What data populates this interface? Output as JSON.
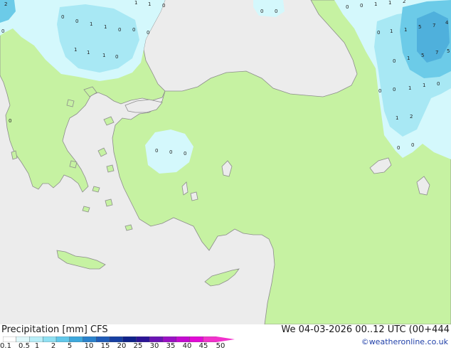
{
  "map": {
    "colors": {
      "sea": "#ececec",
      "land": "#c6f2a2",
      "coast": "#8c8c8c",
      "precip_light": "#d4f8fc",
      "precip_mid": "#a8e8f4",
      "precip_heavy": "#6ccbe8",
      "precip_max": "#4fb0dc"
    },
    "labels": [
      {
        "t": "2"
      },
      {
        "t": "0"
      },
      {
        "t": "1"
      },
      {
        "t": "1"
      },
      {
        "t": "0"
      },
      {
        "t": "0"
      },
      {
        "t": "1"
      },
      {
        "t": "1"
      },
      {
        "t": "0"
      },
      {
        "t": "0"
      },
      {
        "t": "0"
      },
      {
        "t": "1"
      },
      {
        "t": "1"
      },
      {
        "t": "1"
      },
      {
        "t": "0"
      },
      {
        "t": "0"
      },
      {
        "t": "0"
      },
      {
        "t": "0"
      },
      {
        "t": "0"
      },
      {
        "t": "0"
      },
      {
        "t": "1"
      },
      {
        "t": "1"
      },
      {
        "t": "2"
      },
      {
        "t": "0"
      },
      {
        "t": "1"
      },
      {
        "t": "1"
      },
      {
        "t": "5"
      },
      {
        "t": "7"
      },
      {
        "t": "0"
      },
      {
        "t": "1"
      },
      {
        "t": "5"
      },
      {
        "t": "7"
      },
      {
        "t": "5"
      },
      {
        "t": "4"
      },
      {
        "t": "0"
      },
      {
        "t": "0"
      },
      {
        "t": "1"
      },
      {
        "t": "1"
      },
      {
        "t": "1"
      },
      {
        "t": "2"
      },
      {
        "t": "0"
      },
      {
        "t": "0"
      },
      {
        "t": "0"
      },
      {
        "t": "0"
      },
      {
        "t": "0"
      },
      {
        "t": "0"
      },
      {
        "t": "0"
      }
    ]
  },
  "footer": {
    "title": "Precipitation [mm]  CFS",
    "datetime": "We 04-03-2026 00..12 UTC (00+444",
    "credit": "©weatheronline.co.uk",
    "scale_colors": [
      "#ffffff",
      "#dff8fb",
      "#b8eef8",
      "#8fe0f2",
      "#62c8ea",
      "#3ea8dc",
      "#2a82cc",
      "#1f5cb8",
      "#173fa2",
      "#0f228a",
      "#2c1496",
      "#6a14b4",
      "#9a10c4",
      "#c40ad0",
      "#e20ad6",
      "#f232cc"
    ],
    "scale_ticks": [
      "0.1",
      "0.5",
      "1",
      "2",
      "5",
      "10",
      "15",
      "20",
      "25",
      "30",
      "35",
      "40",
      "45",
      "50"
    ]
  }
}
